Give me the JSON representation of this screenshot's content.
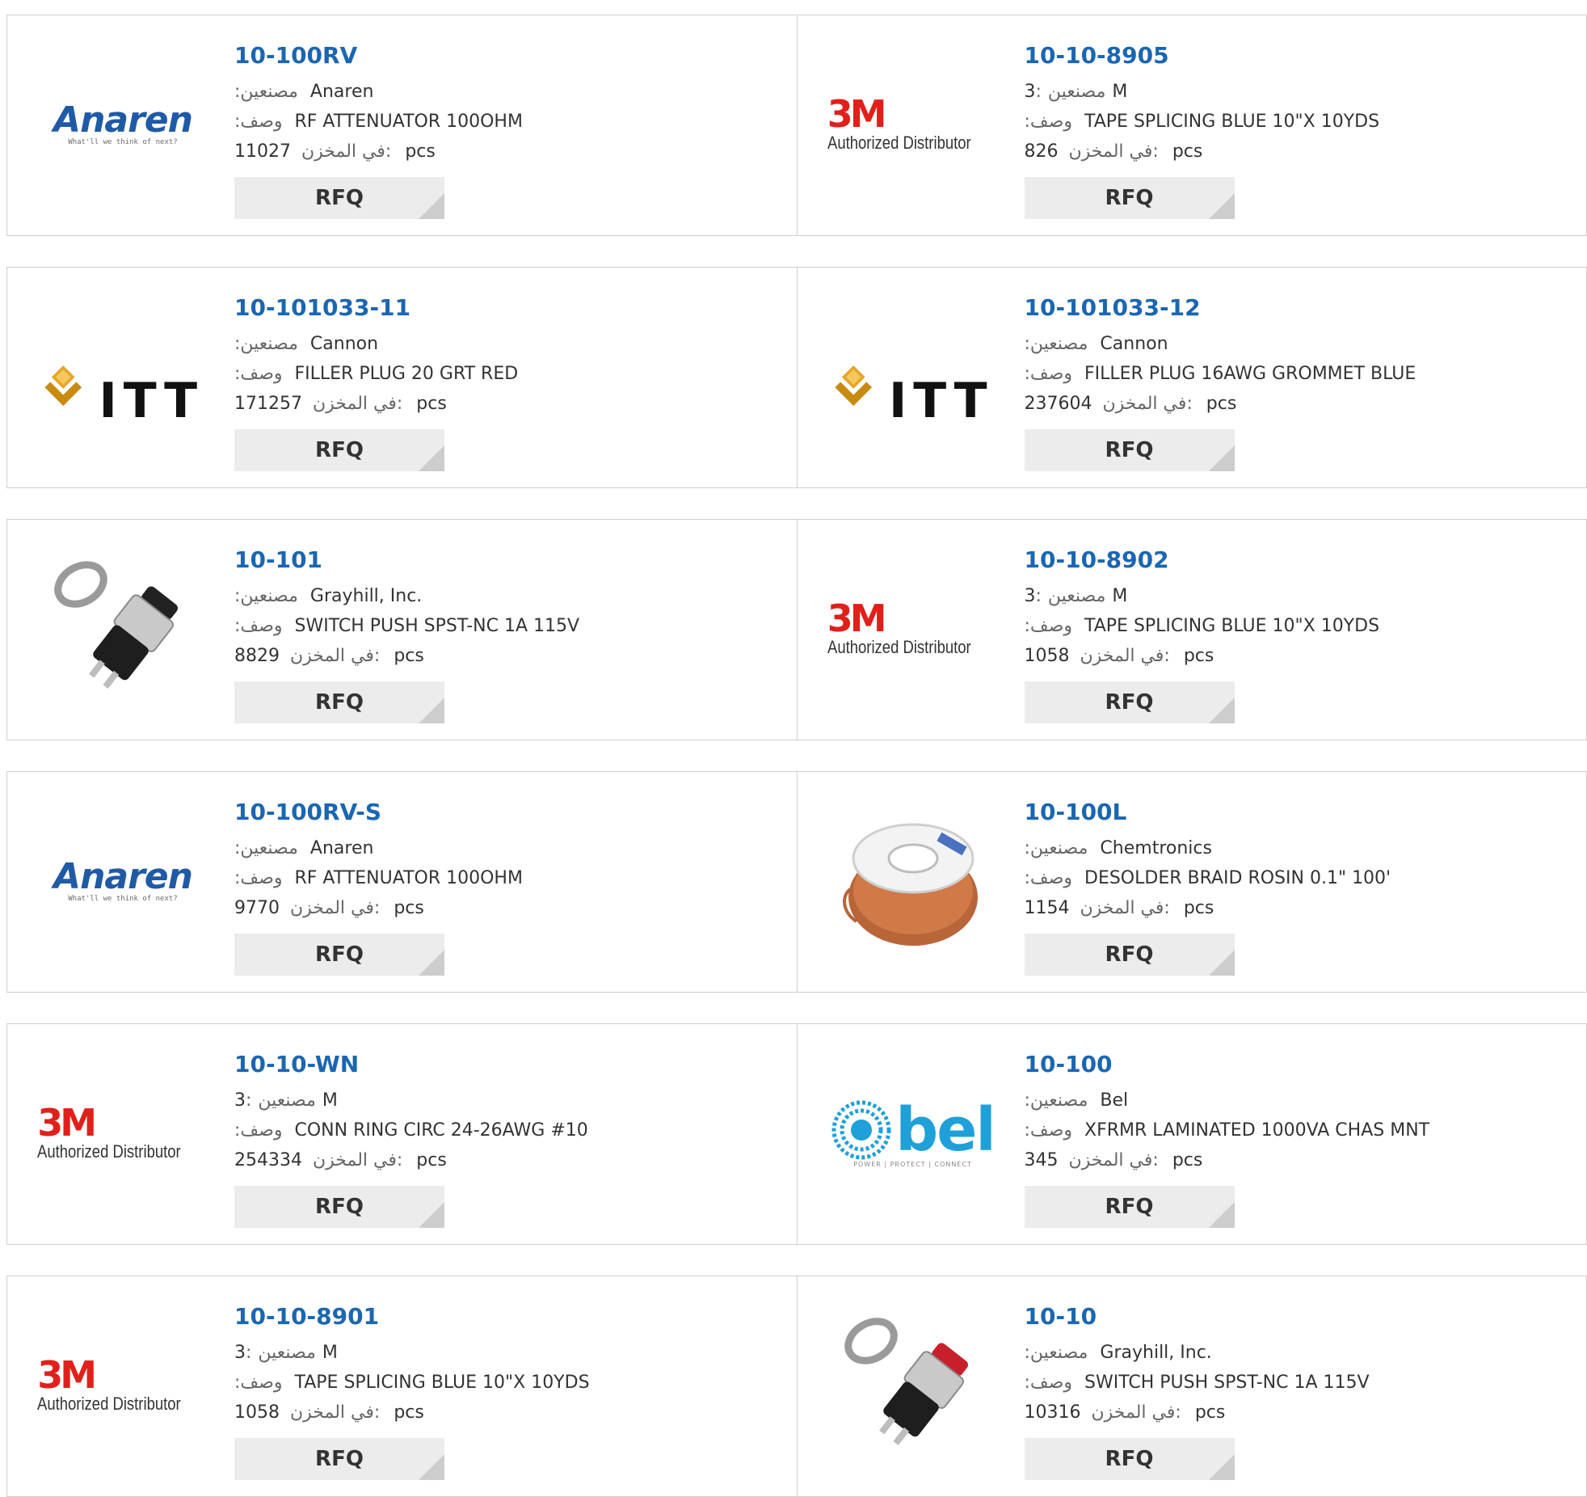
{
  "labels": {
    "manufacturer": ":مصنعين",
    "description": ":وصف",
    "stock": "في المخزن:",
    "unit": "pcs",
    "rfq": "RFQ"
  },
  "rows": [
    [
      {
        "part": "10-100RV",
        "logo": "anaren-logo",
        "mfr_val": "Anaren",
        "mfr_order": "label-first",
        "desc": "RF ATTENUATOR 100OHM",
        "stock": "11027"
      },
      {
        "part": "10-10-8905",
        "logo": "3m-authorized-distributor-logo",
        "mfr_val": "3",
        "mfr_prefix": "M",
        "mfr_order": "3m",
        "desc": "TAPE SPLICING BLUE 10\"X 10YDS",
        "stock": "826"
      }
    ],
    [
      {
        "part": "10-101033-11",
        "logo": "itt-logo",
        "mfr_val": "Cannon",
        "mfr_order": "label-first",
        "desc": "FILLER PLUG 20 GRT RED",
        "stock": "171257"
      },
      {
        "part": "10-101033-12",
        "logo": "itt-logo",
        "mfr_val": "Cannon",
        "mfr_order": "label-first",
        "desc": "FILLER PLUG 16AWG GROMMET BLUE",
        "stock": "237604"
      }
    ],
    [
      {
        "part": "10-101",
        "logo": "push-switch-black-image",
        "mfr_val": "Grayhill, Inc.",
        "mfr_order": "label-first",
        "desc": "SWITCH PUSH SPST-NC 1A 115V",
        "stock": "8829"
      },
      {
        "part": "10-10-8902",
        "logo": "3m-authorized-distributor-logo",
        "mfr_val": "3",
        "mfr_prefix": "M",
        "mfr_order": "3m",
        "desc": "TAPE SPLICING BLUE 10\"X 10YDS",
        "stock": "1058"
      }
    ],
    [
      {
        "part": "10-100RV-S",
        "logo": "anaren-logo",
        "mfr_val": "Anaren",
        "mfr_order": "label-first",
        "desc": "RF ATTENUATOR 100OHM",
        "stock": "9770"
      },
      {
        "part": "10-100L",
        "logo": "desolder-braid-spool-image",
        "mfr_val": "Chemtronics",
        "mfr_order": "label-first",
        "desc": "DESOLDER BRAID ROSIN 0.1\" 100'",
        "stock": "1154"
      }
    ],
    [
      {
        "part": "10-10-WN",
        "logo": "3m-authorized-distributor-logo",
        "mfr_val": "3",
        "mfr_prefix": "M",
        "mfr_order": "3m",
        "desc": "CONN RING CIRC 24-26AWG #10",
        "stock": "254334"
      },
      {
        "part": "10-100",
        "logo": "bel-logo",
        "mfr_val": "Bel",
        "mfr_order": "label-first",
        "desc": "XFRMR LAMINATED 1000VA CHAS MNT",
        "stock": "345"
      }
    ],
    [
      {
        "part": "10-10-8901",
        "logo": "3m-authorized-distributor-logo",
        "mfr_val": "3",
        "mfr_prefix": "M",
        "mfr_order": "3m",
        "desc": "TAPE SPLICING BLUE 10\"X 10YDS",
        "stock": "1058"
      },
      {
        "part": "10-10",
        "logo": "push-switch-red-image",
        "mfr_val": "Grayhill, Inc.",
        "mfr_order": "label-first",
        "desc": "SWITCH PUSH SPST-NC 1A 115V",
        "stock": "10316"
      }
    ]
  ],
  "logos": {
    "anaren": {
      "text": "Anaren",
      "tagline": "What'll we think of next?"
    },
    "3m": {
      "text": "3M",
      "sub": "Authorized Distributor"
    },
    "itt": {
      "text": "ITT"
    },
    "bel": {
      "text": "bel",
      "tagline": "POWER | PROTECT | CONNECT"
    }
  },
  "colors": {
    "part_link": "#1b66b1",
    "rfq_bg": "#ececec",
    "anaren_blue": "#1f5aa6",
    "3m_red": "#e0201b",
    "bel_blue": "#1fa0d8",
    "itt_gold": "#e6a52a"
  }
}
